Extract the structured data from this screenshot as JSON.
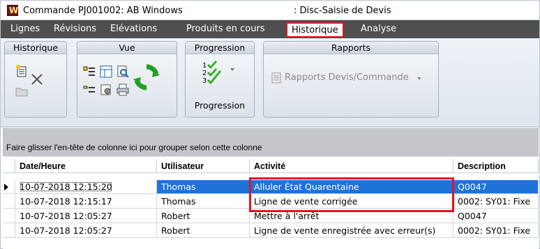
{
  "titlebar": {
    "left": "Commande PJ001002: AB Windows",
    "right": ": Disc-Saisie de Devis"
  },
  "menu": [
    "Lignes",
    "Révisions",
    "Elévations",
    "Produits en cours",
    "Historique",
    "Analyse"
  ],
  "ribbon": {
    "groups": [
      "Historique",
      "Vue",
      "Progression",
      "Rapports"
    ],
    "progression_label": "Progression",
    "rapports_label": "Rapports Devis/Commande"
  },
  "grid": {
    "drag_hint": "Faire glisser l'en-tête de colonne ici pour grouper selon cette colonne",
    "columns": [
      "Date/Heure",
      "Utilisateur",
      "Activité",
      "Description"
    ],
    "rows": [
      [
        "10-07-2018 12:15:20",
        "Thomas",
        "Alluler État Quarentaine",
        "Q0047"
      ],
      [
        "10-07-2018 12:15:17",
        "Thomas",
        "Ligne de vente corrigée",
        "0002: SY01: Fixe"
      ],
      [
        "10-07-2018 12:05:27",
        "Robert",
        "Mettre à l'arrêt",
        "Q0047"
      ],
      [
        "10-07-2018 12:05:27",
        "Robert",
        "Ligne de vente enregistrée avec erreur(s)",
        "0002: SY01: Fixe"
      ]
    ]
  },
  "colors": {
    "menubar": "#4f4f4f",
    "highlight": "#e0141e",
    "selection": "#1e73d8"
  }
}
